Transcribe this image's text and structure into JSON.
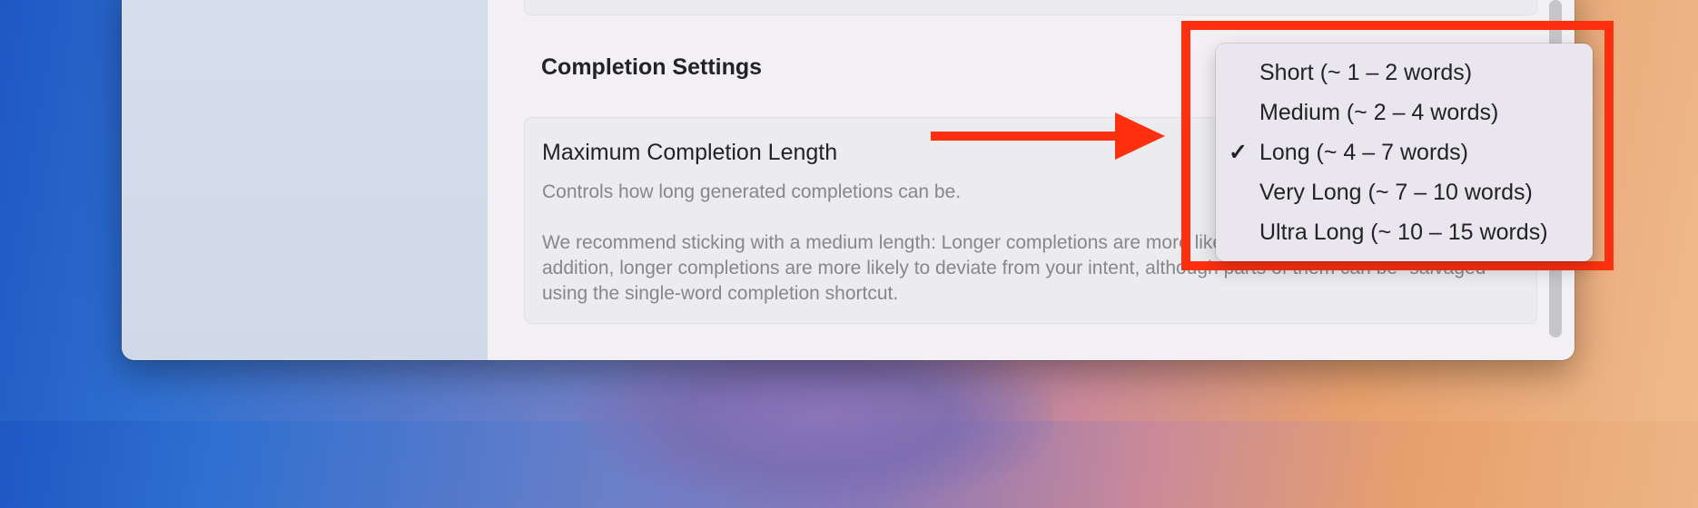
{
  "section": {
    "title": "Completion Settings"
  },
  "setting": {
    "title": "Maximum Completion Length",
    "description": "Controls how long generated completions can be.",
    "note": "We recommend sticking with a medium length: Longer completions are more likely to interrupt your typing flow. In addition, longer completions are more likely to deviate from your intent, although parts of them can be \"salvaged\" using the single-word completion shortcut."
  },
  "menu": {
    "items": [
      {
        "label": "Short (~ 1 – 2 words)",
        "check": ""
      },
      {
        "label": "Medium (~ 2 – 4 words)",
        "check": ""
      },
      {
        "label": "Long (~ 4 – 7 words)",
        "check": "✓"
      },
      {
        "label": "Very Long (~ 7 – 10 words)",
        "check": ""
      },
      {
        "label": "Ultra Long (~ 10 – 15 words)",
        "check": ""
      }
    ],
    "selected": "Long (~ 4 – 7 words)"
  },
  "colors": {
    "annotation": "#ff3010",
    "accent_text": "#232325",
    "secondary_text": "#87868c"
  },
  "icons": {
    "checkmark": "checkmark-icon",
    "annotation_arrow": "arrow-right-icon"
  }
}
